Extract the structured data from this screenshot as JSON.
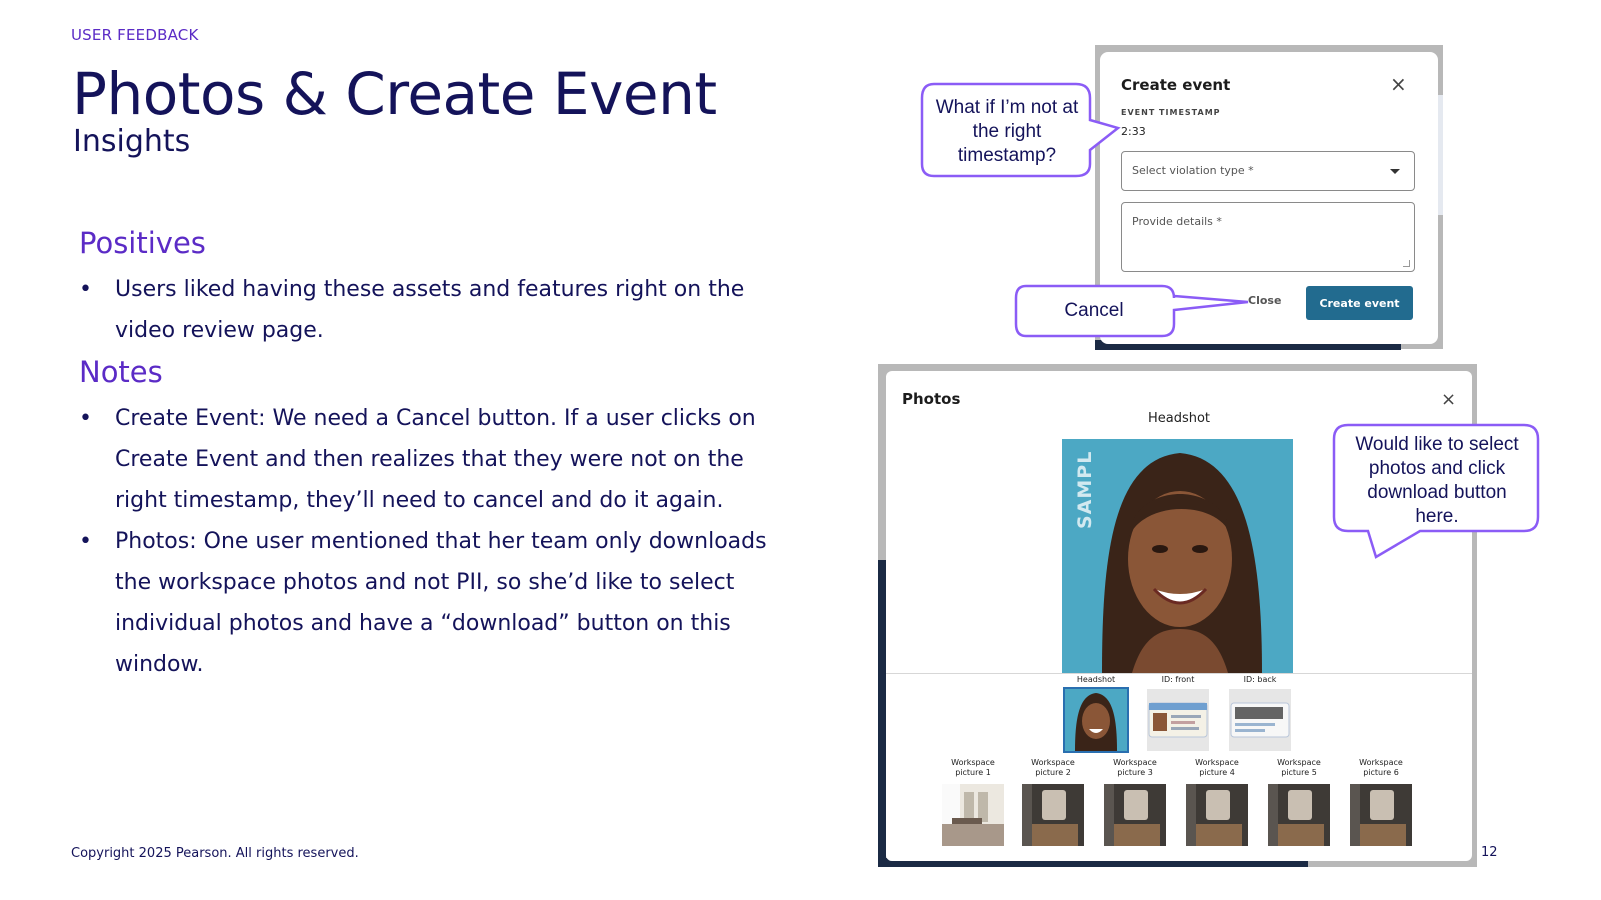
{
  "slide": {
    "eyebrow": "USER FEEDBACK",
    "title": "Photos & Create Event",
    "subtitle": "Insights",
    "positives_heading": "Positives",
    "positives": [
      "Users liked having these assets and features right on the video review page."
    ],
    "notes_heading": "Notes",
    "notes": [
      "Create Event: We need a Cancel button. If a user clicks on Create Event and then realizes that they were not on the right timestamp, they’ll need to cancel and do it again.",
      "Photos: One user mentioned that her team only downloads the workspace photos and not PII, so she’d like to select individual photos and have a “download” button on this window."
    ],
    "bullet_glyph": "•",
    "footer": "Copyright 2025 Pearson. All rights reserved.",
    "page_number": "12"
  },
  "create_event_dialog": {
    "title": "Create event",
    "close_icon": "×",
    "timestamp_label": "EVENT TIMESTAMP",
    "timestamp_value": "2:33",
    "violation_placeholder": "Select violation type *",
    "details_placeholder": "Provide details *",
    "close_label": "Close",
    "create_label": "Create event",
    "primary_color": "#226b8f"
  },
  "photos_dialog": {
    "title": "Photos",
    "close_icon": "×",
    "main_label": "Headshot",
    "main_watermark": "SAMPL",
    "id_row": [
      {
        "label": "Headshot",
        "selected": true
      },
      {
        "label": "ID: front",
        "selected": false
      },
      {
        "label": "ID: back",
        "selected": false
      }
    ],
    "workspace_row": [
      {
        "label": "Workspace picture 1"
      },
      {
        "label": "Workspace picture 2"
      },
      {
        "label": "Workspace picture 3"
      },
      {
        "label": "Workspace picture 4"
      },
      {
        "label": "Workspace picture 5"
      },
      {
        "label": "Workspace picture 6"
      }
    ]
  },
  "callouts": {
    "timestamp": "What if I’m not at the right timestamp?",
    "cancel": "Cancel",
    "download": "Would like to select photos and click download button here."
  },
  "colors": {
    "accent_purple": "#5b2bc6",
    "navy_text": "#14135a",
    "callout_border": "#8b5cf6"
  }
}
